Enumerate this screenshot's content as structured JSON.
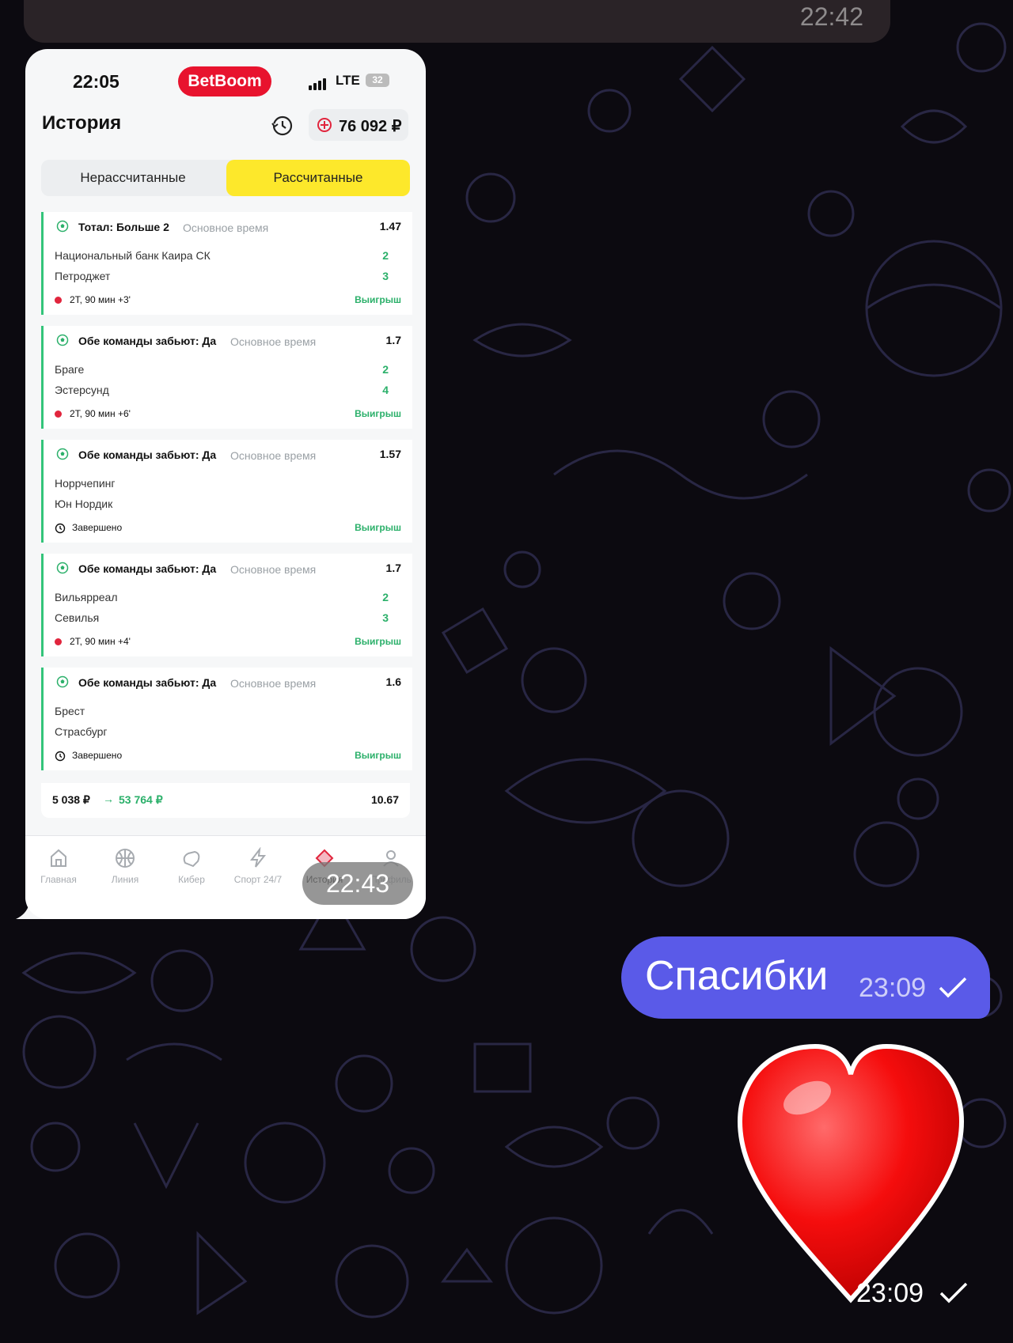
{
  "chat": {
    "prev_message_time": "22:42",
    "screenshot_time": "22:43",
    "outgoing_message": {
      "text": "Спасибки",
      "time": "23:09"
    },
    "sticker": {
      "name": "red-heart",
      "time": "23:09"
    }
  },
  "phone": {
    "status": {
      "clock": "22:05",
      "brand": "BetBoom",
      "network": "LTE",
      "battery": "32"
    },
    "header": {
      "title": "История",
      "balance": "76 092 ₽"
    },
    "tabs": [
      "Нерассчитанные",
      "Рассчитанные"
    ],
    "bets": [
      {
        "bet": "Тотал: Больше 2",
        "period": "Основное время",
        "coef": "1.47",
        "team1": "Национальный банк Каира СК",
        "team2": "Петроджет",
        "score1": "2",
        "score2": "3",
        "status": "2Т, 90 мин +3'",
        "status_type": "live",
        "result": "Выигрыш"
      },
      {
        "bet": "Обе команды забьют: Да",
        "period": "Основное время",
        "coef": "1.7",
        "team1": "Браге",
        "team2": "Эстерсунд",
        "score1": "2",
        "score2": "4",
        "status": "2Т, 90 мин +6'",
        "status_type": "live",
        "result": "Выигрыш"
      },
      {
        "bet": "Обе команды забьют: Да",
        "period": "Основное время",
        "coef": "1.57",
        "team1": "Норрчепинг",
        "team2": "Юн Нордик",
        "score1": "",
        "score2": "",
        "status": "Завершено",
        "status_type": "finished",
        "result": "Выигрыш"
      },
      {
        "bet": "Обе команды забьют: Да",
        "period": "Основное время",
        "coef": "1.7",
        "team1": "Вильярреал",
        "team2": "Севилья",
        "score1": "2",
        "score2": "3",
        "status": "2Т, 90 мин +4'",
        "status_type": "live",
        "result": "Выигрыш"
      },
      {
        "bet": "Обе команды забьют: Да",
        "period": "Основное время",
        "coef": "1.6",
        "team1": "Брест",
        "team2": "Страсбург",
        "score1": "",
        "score2": "",
        "status": "Завершено",
        "status_type": "finished",
        "result": "Выигрыш"
      }
    ],
    "total": {
      "stake": "5 038 ₽",
      "arrow": "→",
      "win": "53 764 ₽",
      "coef": "10.67"
    },
    "nav": [
      {
        "label": "Главная",
        "icon": "home-icon"
      },
      {
        "label": "Линия",
        "icon": "basketball-icon"
      },
      {
        "label": "Кибер",
        "icon": "gamepad-icon"
      },
      {
        "label": "Спорт 24/7",
        "icon": "lightning-icon"
      },
      {
        "label": "История",
        "icon": "ticket-icon",
        "active": true
      },
      {
        "label": "Профиль",
        "icon": "profile-icon"
      }
    ]
  },
  "colors": {
    "brand": "#e8132e",
    "accent_tab": "#fde82b",
    "win": "#2bb06a",
    "outgoing_bubble": "#5a5ae8"
  }
}
